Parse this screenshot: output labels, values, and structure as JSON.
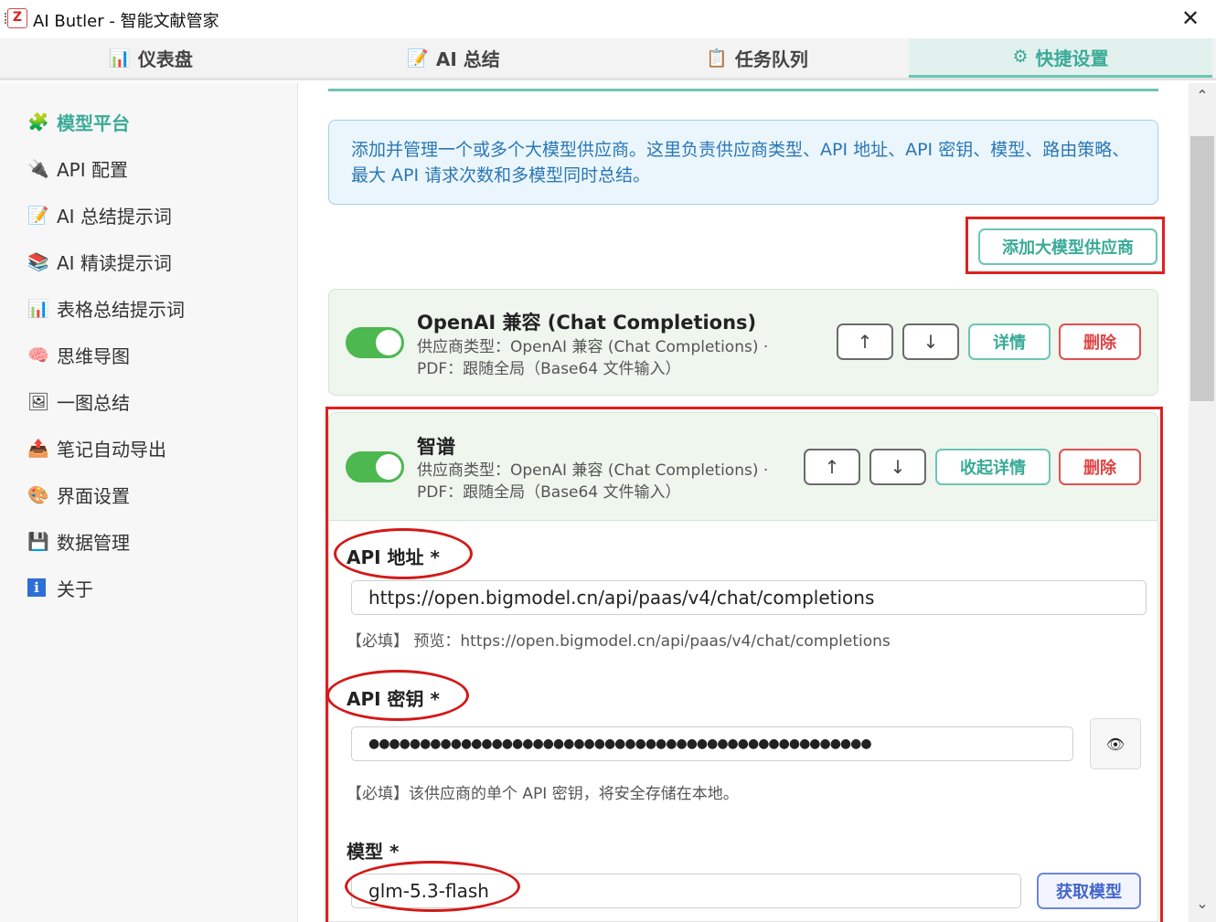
{
  "window": {
    "title": "AI Butler - 智能文献管家",
    "app_icon": "Z",
    "close_glyph": "✕"
  },
  "tabs": [
    {
      "icon": "📊",
      "label": "仪表盘",
      "active": false
    },
    {
      "icon": "📝",
      "label": "AI 总结",
      "active": false
    },
    {
      "icon": "📋",
      "label": "任务队列",
      "active": false
    },
    {
      "icon": "⚙",
      "label": "快捷设置",
      "active": true
    }
  ],
  "sidebar": {
    "items": [
      {
        "icon": "🧩",
        "label": "模型平台",
        "active": true
      },
      {
        "icon": "🔌",
        "label": "API 配置"
      },
      {
        "icon": "📝",
        "label": "AI 总结提示词"
      },
      {
        "icon": "📚",
        "label": "AI 精读提示词"
      },
      {
        "icon": "📊",
        "label": "表格总结提示词"
      },
      {
        "icon": "🧠",
        "label": "思维导图"
      },
      {
        "icon": "🖼",
        "label": "一图总结"
      },
      {
        "icon": "📤",
        "label": "笔记自动导出"
      },
      {
        "icon": "🎨",
        "label": "界面设置"
      },
      {
        "icon": "💾",
        "label": "数据管理"
      },
      {
        "icon": "ℹ",
        "label": "关于"
      }
    ]
  },
  "main": {
    "info_text": "添加并管理一个或多个大模型供应商。这里负责供应商类型、API 地址、API 密钥、模型、路由策略、最大 API 请求次数和多模型同时总结。",
    "add_provider_label": "添加大模型供应商",
    "providers": [
      {
        "name": "OpenAI 兼容 (Chat Completions)",
        "meta_line1": "供应商类型：OpenAI 兼容 (Chat Completions) ·",
        "meta_line2": "PDF：跟随全局（Base64 文件输入）",
        "enabled": true,
        "up": "↑",
        "down": "↓",
        "details_label": "详情",
        "delete_label": "删除"
      },
      {
        "name": "智谱",
        "meta_line1": "供应商类型：OpenAI 兼容 (Chat Completions) ·",
        "meta_line2": "PDF：跟随全局（Base64 文件输入）",
        "enabled": true,
        "up": "↑",
        "down": "↓",
        "details_label": "收起详情",
        "delete_label": "删除"
      }
    ],
    "form": {
      "api_url_label": "API 地址 *",
      "api_url_value": "https://open.bigmodel.cn/api/paas/v4/chat/completions",
      "api_url_hint": "【必填】 预览：https://open.bigmodel.cn/api/paas/v4/chat/completions",
      "api_key_label": "API 密钥 *",
      "api_key_value": "●●●●●●●●●●●●●●●●●●●●●●●●●●●●●●●●●●●●●●●●●●●●●●●●●",
      "api_key_hint": "【必填】该供应商的单个 API 密钥，将安全存储在本地。",
      "eye_glyph": "👁",
      "model_label": "模型 *",
      "model_value": "glm-5.3-flash",
      "fetch_models_label": "获取模型"
    }
  },
  "scrollbar": {
    "up": "⌃",
    "down": "⌄"
  },
  "colors": {
    "accent": "#3aab98",
    "toggle_on": "#4cb84f",
    "danger": "#e04545",
    "info_text": "#2b77b6",
    "annotation": "#e02020"
  }
}
